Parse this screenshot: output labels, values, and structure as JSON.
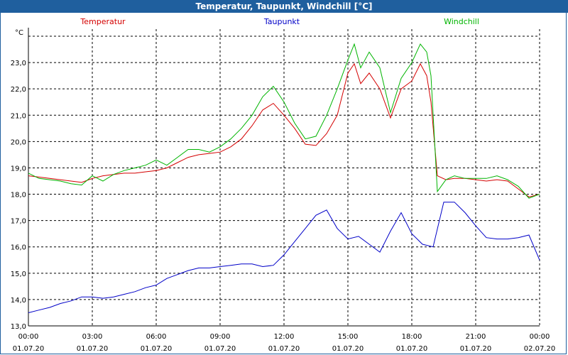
{
  "window": {
    "title": "Temperatur, Taupunkt, Windchill [°C]"
  },
  "chart_data": {
    "type": "line",
    "title": "Temperatur, Taupunkt, Windchill [°C]",
    "ylabel": "°C",
    "xlabel": "",
    "ylim": [
      13.0,
      24.0
    ],
    "yticks": [
      "13,0",
      "14,0",
      "15,0",
      "16,0",
      "17,0",
      "18,0",
      "19,0",
      "20,0",
      "21,0",
      "22,0",
      "23,0"
    ],
    "xlim": [
      0,
      24
    ],
    "xticks": [
      {
        "x": 0,
        "time": "00:00",
        "date": "01.07.20"
      },
      {
        "x": 3,
        "time": "03:00",
        "date": "01.07.20"
      },
      {
        "x": 6,
        "time": "06:00",
        "date": "01.07.20"
      },
      {
        "x": 9,
        "time": "09:00",
        "date": "01.07.20"
      },
      {
        "x": 12,
        "time": "12:00",
        "date": "01.07.20"
      },
      {
        "x": 15,
        "time": "15:00",
        "date": "01.07.20"
      },
      {
        "x": 18,
        "time": "18:00",
        "date": "01.07.20"
      },
      {
        "x": 21,
        "time": "21:00",
        "date": "01.07.20"
      },
      {
        "x": 24,
        "time": "00:00",
        "date": "02.07.20"
      }
    ],
    "grid": true,
    "legend_position": "top",
    "series": [
      {
        "name": "Temperatur",
        "color": "#d40000",
        "x": [
          0,
          0.5,
          1,
          1.5,
          2,
          2.5,
          3,
          3.5,
          4,
          4.5,
          5,
          5.5,
          6,
          6.5,
          7,
          7.5,
          8,
          8.5,
          9,
          9.5,
          10,
          10.5,
          11,
          11.5,
          12,
          12.5,
          13,
          13.5,
          14,
          14.5,
          15,
          15.3,
          15.6,
          16,
          16.5,
          17,
          17.5,
          18,
          18.4,
          18.7,
          18.9,
          19.2,
          19.6,
          20,
          20.5,
          21,
          21.5,
          22,
          22.5,
          23,
          23.5,
          24
        ],
        "y": [
          18.7,
          18.65,
          18.6,
          18.55,
          18.5,
          18.45,
          18.6,
          18.7,
          18.75,
          18.8,
          18.8,
          18.85,
          18.9,
          19.0,
          19.2,
          19.4,
          19.5,
          19.55,
          19.6,
          19.8,
          20.1,
          20.6,
          21.2,
          21.45,
          21.0,
          20.5,
          19.9,
          19.85,
          20.3,
          21.0,
          22.6,
          22.95,
          22.2,
          22.6,
          22.0,
          20.9,
          22.0,
          22.3,
          22.95,
          22.5,
          21.5,
          18.7,
          18.55,
          18.6,
          18.6,
          18.55,
          18.5,
          18.55,
          18.5,
          18.2,
          17.9,
          18.0
        ]
      },
      {
        "name": "Taupunkt",
        "color": "#0000c8",
        "x": [
          0,
          0.5,
          1,
          1.5,
          2,
          2.5,
          3,
          3.5,
          4,
          4.5,
          5,
          5.5,
          6,
          6.5,
          7,
          7.5,
          8,
          8.5,
          9,
          9.5,
          10,
          10.5,
          11,
          11.5,
          12,
          12.5,
          13,
          13.5,
          14,
          14.5,
          15,
          15.5,
          16,
          16.5,
          17,
          17.5,
          18,
          18.5,
          19,
          19.5,
          20,
          20.5,
          21,
          21.5,
          22,
          22.5,
          23,
          23.5,
          24
        ],
        "y": [
          13.5,
          13.6,
          13.7,
          13.85,
          13.95,
          14.1,
          14.1,
          14.05,
          14.1,
          14.2,
          14.3,
          14.45,
          14.55,
          14.8,
          14.95,
          15.1,
          15.2,
          15.2,
          15.25,
          15.3,
          15.35,
          15.35,
          15.25,
          15.3,
          15.7,
          16.2,
          16.7,
          17.2,
          17.4,
          16.7,
          16.3,
          16.4,
          16.1,
          15.8,
          16.6,
          17.3,
          16.5,
          16.1,
          16.0,
          17.7,
          17.7,
          17.3,
          16.8,
          16.35,
          16.3,
          16.3,
          16.35,
          16.45,
          15.5
        ]
      },
      {
        "name": "Windchill",
        "color": "#00b400",
        "x": [
          0,
          0.5,
          1,
          1.5,
          2,
          2.5,
          3,
          3.5,
          4,
          4.5,
          5,
          5.5,
          6,
          6.5,
          7,
          7.5,
          8,
          8.5,
          9,
          9.5,
          10,
          10.5,
          11,
          11.5,
          12,
          12.5,
          13,
          13.5,
          14,
          14.5,
          15,
          15.3,
          15.6,
          16,
          16.5,
          17,
          17.5,
          18,
          18.4,
          18.7,
          18.9,
          19.2,
          19.6,
          20,
          20.5,
          21,
          21.5,
          22,
          22.5,
          23,
          23.5,
          24
        ],
        "y": [
          18.8,
          18.6,
          18.55,
          18.5,
          18.4,
          18.35,
          18.7,
          18.5,
          18.75,
          18.9,
          19.0,
          19.1,
          19.3,
          19.1,
          19.4,
          19.7,
          19.7,
          19.6,
          19.8,
          20.1,
          20.5,
          21.0,
          21.7,
          22.1,
          21.5,
          20.7,
          20.1,
          20.2,
          21.0,
          22.0,
          23.1,
          23.7,
          22.8,
          23.4,
          22.8,
          21.1,
          22.4,
          23.0,
          23.7,
          23.4,
          22.5,
          18.1,
          18.55,
          18.7,
          18.6,
          18.6,
          18.6,
          18.7,
          18.55,
          18.3,
          17.85,
          18.0
        ]
      }
    ]
  }
}
